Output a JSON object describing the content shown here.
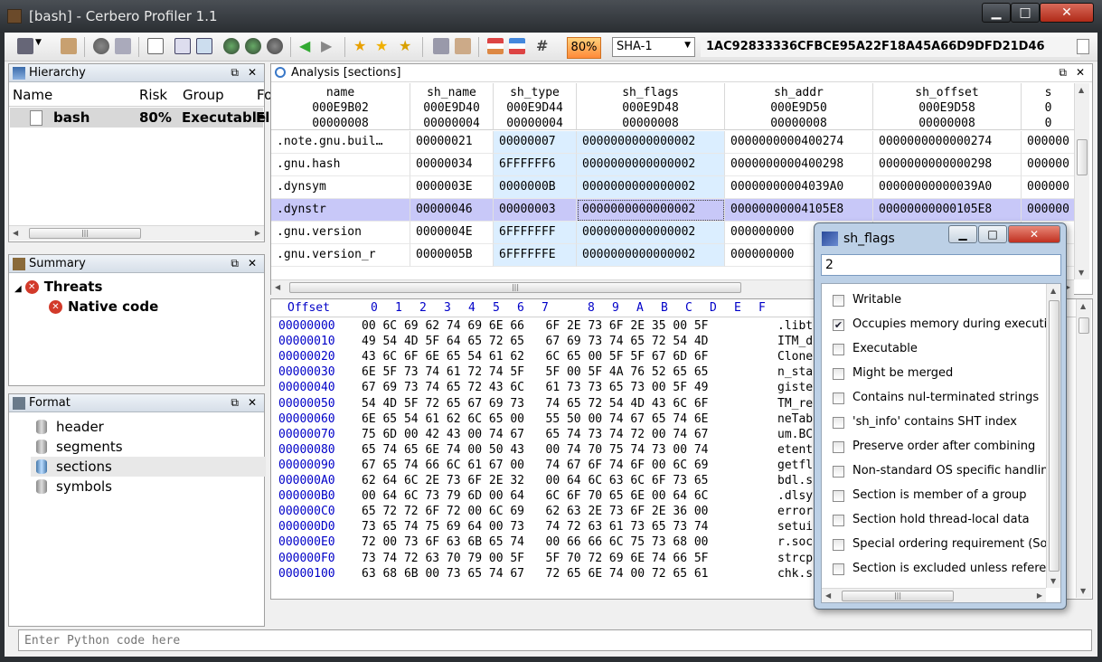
{
  "window": {
    "title": "[bash] - Cerbero Profiler 1.1"
  },
  "toolbar": {
    "risk": "80%",
    "hash_algo": "SHA-1",
    "hash_value": "1AC92833336CFBCE95A22F18A45A66D9DFD21D46",
    "hash_options": [
      "SHA-1"
    ]
  },
  "hierarchy": {
    "title": "Hierarchy",
    "columns": [
      "Name",
      "Risk",
      "Group",
      "Fo"
    ],
    "rows": [
      {
        "name": "bash",
        "risk": "80%",
        "group": "Executable",
        "format": "El"
      }
    ]
  },
  "summary": {
    "title": "Summary",
    "threats_label": "Threats",
    "items": [
      "Native code"
    ]
  },
  "format": {
    "title": "Format",
    "items": [
      "header",
      "segments",
      "sections",
      "symbols"
    ],
    "selected": "sections"
  },
  "analysis": {
    "title": "Analysis [sections]",
    "columns": [
      {
        "name": "name",
        "offset": "000E9B02",
        "size": "00000008"
      },
      {
        "name": "sh_name",
        "offset": "000E9D40",
        "size": "00000004"
      },
      {
        "name": "sh_type",
        "offset": "000E9D44",
        "size": "00000004"
      },
      {
        "name": "sh_flags",
        "offset": "000E9D48",
        "size": "00000008"
      },
      {
        "name": "sh_addr",
        "offset": "000E9D50",
        "size": "00000008"
      },
      {
        "name": "sh_offset",
        "offset": "000E9D58",
        "size": "00000008"
      },
      {
        "name": "s",
        "offset": "0",
        "size": "0"
      }
    ],
    "rows": [
      [
        ".note.gnu.buil…",
        "00000021",
        "00000007",
        "0000000000000002",
        "0000000000400274",
        "0000000000000274",
        "000000"
      ],
      [
        ".gnu.hash",
        "00000034",
        "6FFFFFF6",
        "0000000000000002",
        "0000000000400298",
        "0000000000000298",
        "000000"
      ],
      [
        ".dynsym",
        "0000003E",
        "0000000B",
        "0000000000000002",
        "00000000004039A0",
        "00000000000039A0",
        "000000"
      ],
      [
        ".dynstr",
        "00000046",
        "00000003",
        "0000000000000002",
        "00000000004105E8",
        "00000000000105E8",
        "000000"
      ],
      [
        ".gnu.version",
        "0000004E",
        "6FFFFFFF",
        "0000000000000002",
        "000000000",
        "",
        ""
      ],
      [
        ".gnu.version_r",
        "0000005B",
        "6FFFFFFE",
        "0000000000000002",
        "000000000",
        "",
        ""
      ]
    ],
    "selected_row": 3
  },
  "hex": {
    "header_offset": "Offset",
    "header_cols": [
      "0",
      "1",
      "2",
      "3",
      "4",
      "5",
      "6",
      "7",
      "8",
      "9",
      "A",
      "B",
      "C",
      "D",
      "E",
      "F"
    ],
    "rows": [
      {
        "off": "00000000",
        "bytes": "00 6C 69 62 74 69 6E 66   6F 2E 73 6F 2E 35 00 5F",
        "ascii": ".libt"
      },
      {
        "off": "00000010",
        "bytes": "49 54 4D 5F 64 65 72 65   67 69 73 74 65 72 54 4D",
        "ascii": "ITM_d"
      },
      {
        "off": "00000020",
        "bytes": "43 6C 6F 6E 65 54 61 62   6C 65 00 5F 5F 67 6D 6F",
        "ascii": "Clone"
      },
      {
        "off": "00000030",
        "bytes": "6E 5F 73 74 61 72 74 5F   5F 00 5F 4A 76 52 65 65",
        "ascii": "n_sta"
      },
      {
        "off": "00000040",
        "bytes": "67 69 73 74 65 72 43 6C   61 73 73 65 73 00 5F 49",
        "ascii": "giste"
      },
      {
        "off": "00000050",
        "bytes": "54 4D 5F 72 65 67 69 73   74 65 72 54 4D 43 6C 6F",
        "ascii": "TM_re"
      },
      {
        "off": "00000060",
        "bytes": "6E 65 54 61 62 6C 65 00   55 50 00 74 67 65 74 6E",
        "ascii": "neTab"
      },
      {
        "off": "00000070",
        "bytes": "75 6D 00 42 43 00 74 67   65 74 73 74 72 00 74 67",
        "ascii": "um.BC"
      },
      {
        "off": "00000080",
        "bytes": "65 74 65 6E 74 00 50 43   00 74 70 75 74 73 00 74",
        "ascii": "etent"
      },
      {
        "off": "00000090",
        "bytes": "67 65 74 66 6C 61 67 00   74 67 6F 74 6F 00 6C 69",
        "ascii": "getfl"
      },
      {
        "off": "000000A0",
        "bytes": "62 64 6C 2E 73 6F 2E 32   00 64 6C 63 6C 6F 73 65",
        "ascii": "bdl.s"
      },
      {
        "off": "000000B0",
        "bytes": "00 64 6C 73 79 6D 00 64   6C 6F 70 65 6E 00 64 6C",
        "ascii": ".dlsy"
      },
      {
        "off": "000000C0",
        "bytes": "65 72 72 6F 72 00 6C 69   62 63 2E 73 6F 2E 36 00",
        "ascii": "error"
      },
      {
        "off": "000000D0",
        "bytes": "73 65 74 75 69 64 00 73   74 72 63 61 73 65 73 74",
        "ascii": "setui"
      },
      {
        "off": "000000E0",
        "bytes": "72 00 73 6F 63 6B 65 74   00 66 66 6C 75 73 68 00",
        "ascii": "r.soc"
      },
      {
        "off": "000000F0",
        "bytes": "73 74 72 63 70 79 00 5F   5F 70 72 69 6E 74 66 5F",
        "ascii": "strcp"
      },
      {
        "off": "00000100",
        "bytes": "63 68 6B 00 73 65 74 67   72 65 6E 74 00 72 65 61",
        "ascii": "chk.s"
      }
    ]
  },
  "python": {
    "placeholder": "Enter Python code here"
  },
  "dialog": {
    "title": "sh_flags",
    "value": "2",
    "flags": [
      {
        "label": "Writable",
        "checked": false
      },
      {
        "label": "Occupies memory during execution",
        "checked": true
      },
      {
        "label": "Executable",
        "checked": false
      },
      {
        "label": "Might be merged",
        "checked": false
      },
      {
        "label": "Contains nul-terminated strings",
        "checked": false
      },
      {
        "label": "'sh_info' contains SHT index",
        "checked": false
      },
      {
        "label": "Preserve order after combining",
        "checked": false
      },
      {
        "label": "Non-standard OS specific handling re",
        "checked": false
      },
      {
        "label": "Section is member of a group",
        "checked": false
      },
      {
        "label": "Section hold thread-local data",
        "checked": false
      },
      {
        "label": "Special ordering requirement (Solari",
        "checked": false
      },
      {
        "label": "Section is excluded unless referencec",
        "checked": false
      }
    ]
  }
}
